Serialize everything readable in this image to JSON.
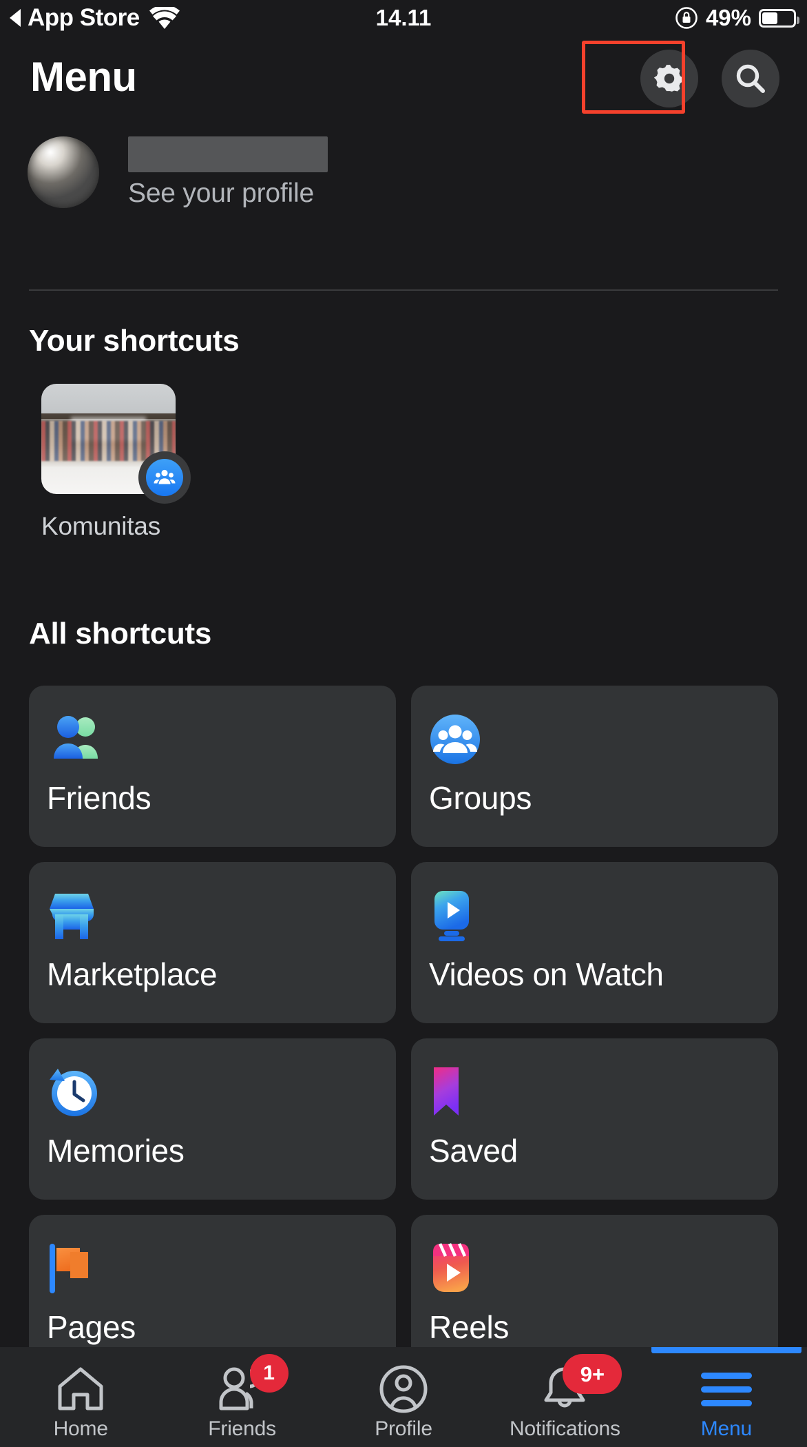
{
  "status_bar": {
    "back_label": "App Store",
    "back_icon": "back-triangle-icon",
    "wifi_icon": "wifi-icon",
    "time": "14.11",
    "lock_icon": "rotation-lock-icon",
    "battery_percent": "49%",
    "battery_level": 49
  },
  "header": {
    "title": "Menu",
    "settings_icon": "gear-icon",
    "search_icon": "search-icon",
    "highlight_target": "settings-button",
    "highlight_color": "#f5412c"
  },
  "profile": {
    "name_redacted": true,
    "subtitle": "See your profile",
    "avatar_icon": "user-avatar"
  },
  "your_shortcuts": {
    "heading": "Your shortcuts",
    "items": [
      {
        "label": "Komunitas",
        "badge_icon": "groups-icon",
        "badge_color": "#1877f2"
      }
    ]
  },
  "all_shortcuts": {
    "heading": "All shortcuts",
    "tiles": [
      {
        "label": "Friends",
        "icon": "friends-icon",
        "color": "#1b74e4"
      },
      {
        "label": "Groups",
        "icon": "groups-icon",
        "color": "#2d88ff"
      },
      {
        "label": "Marketplace",
        "icon": "marketplace-icon",
        "color": "#3b9ae1"
      },
      {
        "label": "Videos on Watch",
        "icon": "watch-icon",
        "color": "#2d88ff"
      },
      {
        "label": "Memories",
        "icon": "memories-icon",
        "color": "#1b74e4"
      },
      {
        "label": "Saved",
        "icon": "saved-icon",
        "color": "#b536d6"
      },
      {
        "label": "Pages",
        "icon": "pages-icon",
        "color": "#f0803c"
      },
      {
        "label": "Reels",
        "icon": "reels-icon",
        "color": "#f0549a"
      }
    ]
  },
  "bottom_nav": {
    "items": [
      {
        "label": "Home",
        "icon": "home-icon",
        "badge": "",
        "active": false
      },
      {
        "label": "Friends",
        "icon": "friends-nav-icon",
        "badge": "1",
        "active": false
      },
      {
        "label": "Profile",
        "icon": "profile-icon",
        "badge": "",
        "active": false
      },
      {
        "label": "Notifications",
        "icon": "bell-icon",
        "badge": "9+",
        "active": false
      },
      {
        "label": "Menu",
        "icon": "hamburger-icon",
        "badge": "",
        "active": true
      }
    ],
    "active_color": "#2d88ff",
    "badge_color": "#e4293a"
  }
}
